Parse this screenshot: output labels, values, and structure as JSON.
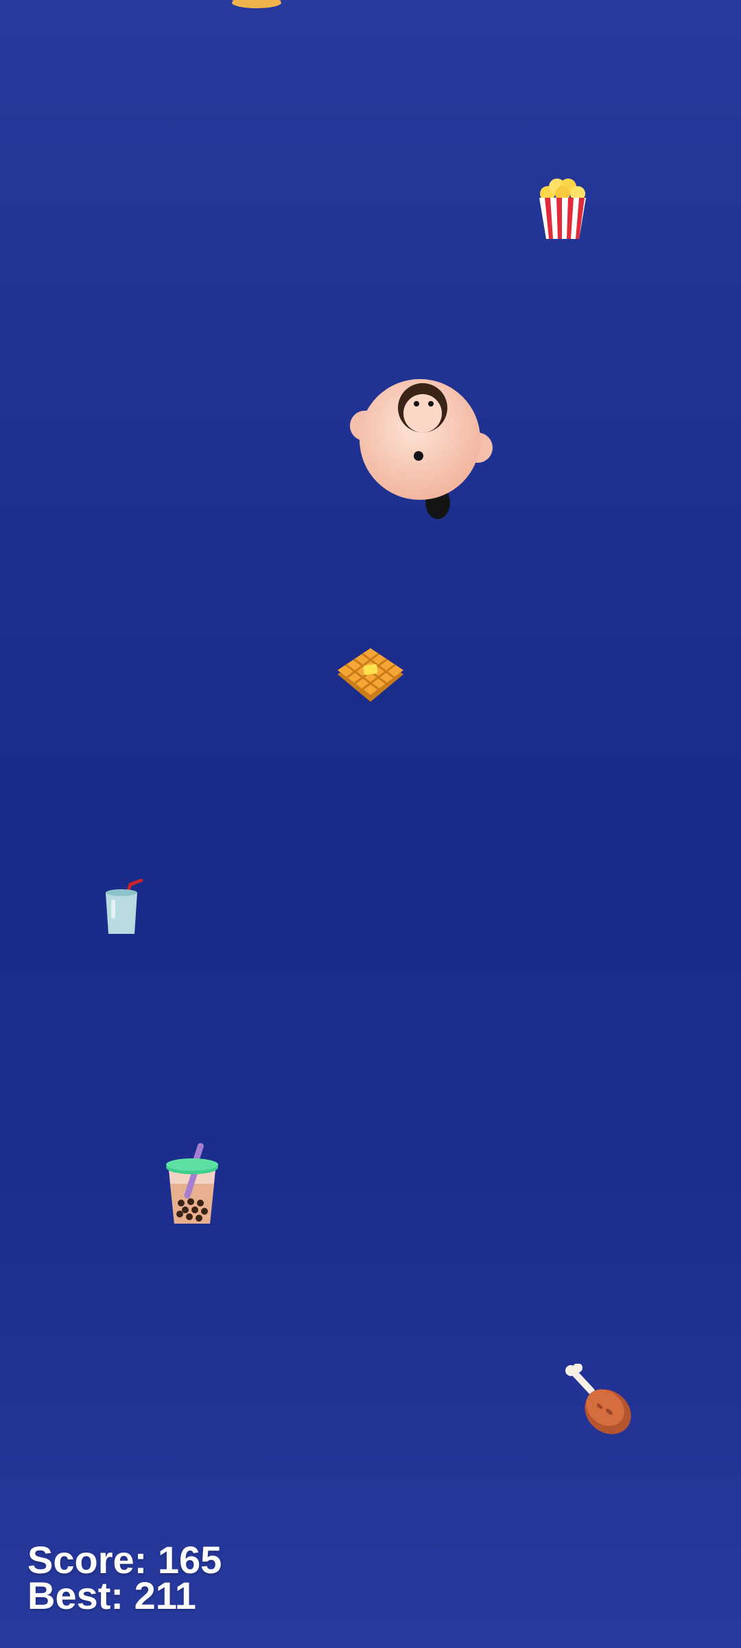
{
  "hud": {
    "score_label": "Score:",
    "score_value": "165",
    "best_label": "Best:",
    "best_value": "211"
  },
  "scene": {
    "background_colors": [
      "#283a9e",
      "#1a2a88",
      "#283a9e"
    ],
    "player": "round-pink-character",
    "foods": [
      "donut",
      "popcorn",
      "waffle",
      "drink-cup",
      "bubble-tea",
      "chicken-drumstick"
    ]
  }
}
